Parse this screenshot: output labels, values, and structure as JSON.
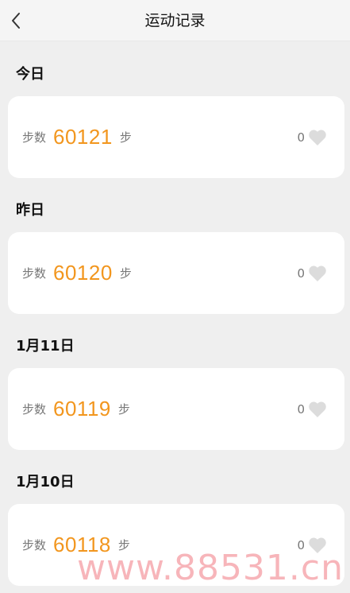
{
  "header": {
    "title": "运动记录"
  },
  "records": [
    {
      "day": "今日",
      "steps_label": "步数",
      "steps": "60121",
      "unit": "步",
      "likes": "0"
    },
    {
      "day": "昨日",
      "steps_label": "步数",
      "steps": "60120",
      "unit": "步",
      "likes": "0"
    },
    {
      "day": "1月11日",
      "steps_label": "步数",
      "steps": "60119",
      "unit": "步",
      "likes": "0"
    },
    {
      "day": "1月10日",
      "steps_label": "步数",
      "steps": "60118",
      "unit": "步",
      "likes": "0"
    }
  ],
  "watermark": "www.88531.cn",
  "colors": {
    "accent": "#f2961e",
    "background": "#efefef",
    "card": "#ffffff",
    "heart": "#dcdcdc"
  },
  "icons": {
    "back": "chevron-left-icon",
    "like": "heart-icon"
  }
}
